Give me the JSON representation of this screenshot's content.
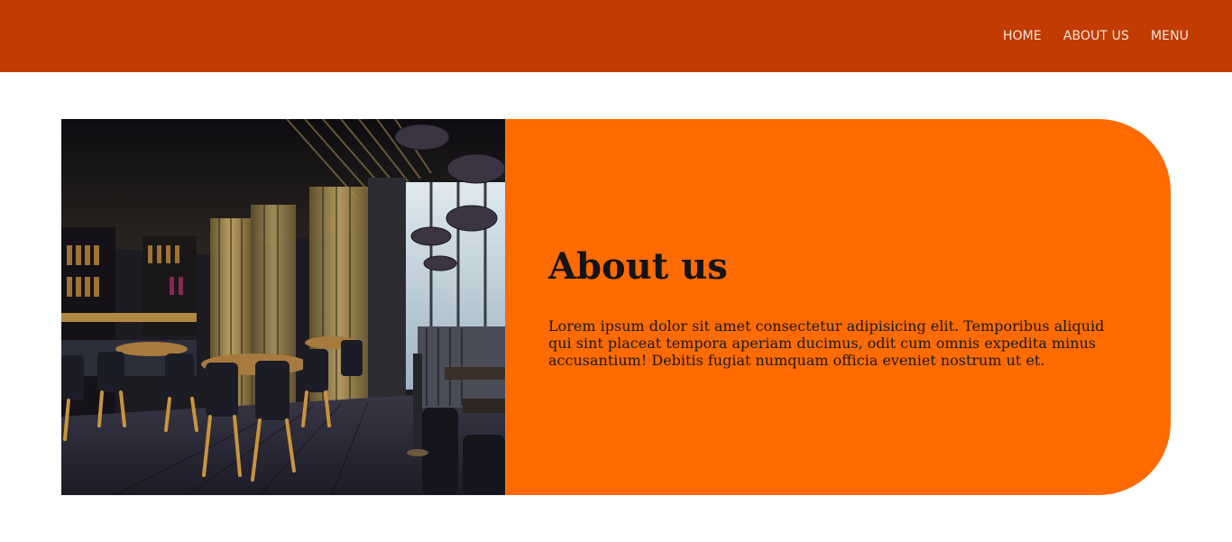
{
  "nav": {
    "items": [
      {
        "label": "HOME"
      },
      {
        "label": "ABOUT US"
      },
      {
        "label": "MENU"
      }
    ]
  },
  "about": {
    "title": "About us",
    "body": "Lorem ipsum dolor sit amet consectetur adipisicing elit. Temporibus aliquid qui sint placeat tempora aperiam ducimus, odit cum omnis expedita minus accusantium! Debitis fugiat numquam officia eveniet nostrum ut et.",
    "image_subject": "restaurant-interior"
  },
  "colors": {
    "header": "#c23b00",
    "panel": "#ff6b00",
    "nav_text": "#f7e6dc"
  }
}
